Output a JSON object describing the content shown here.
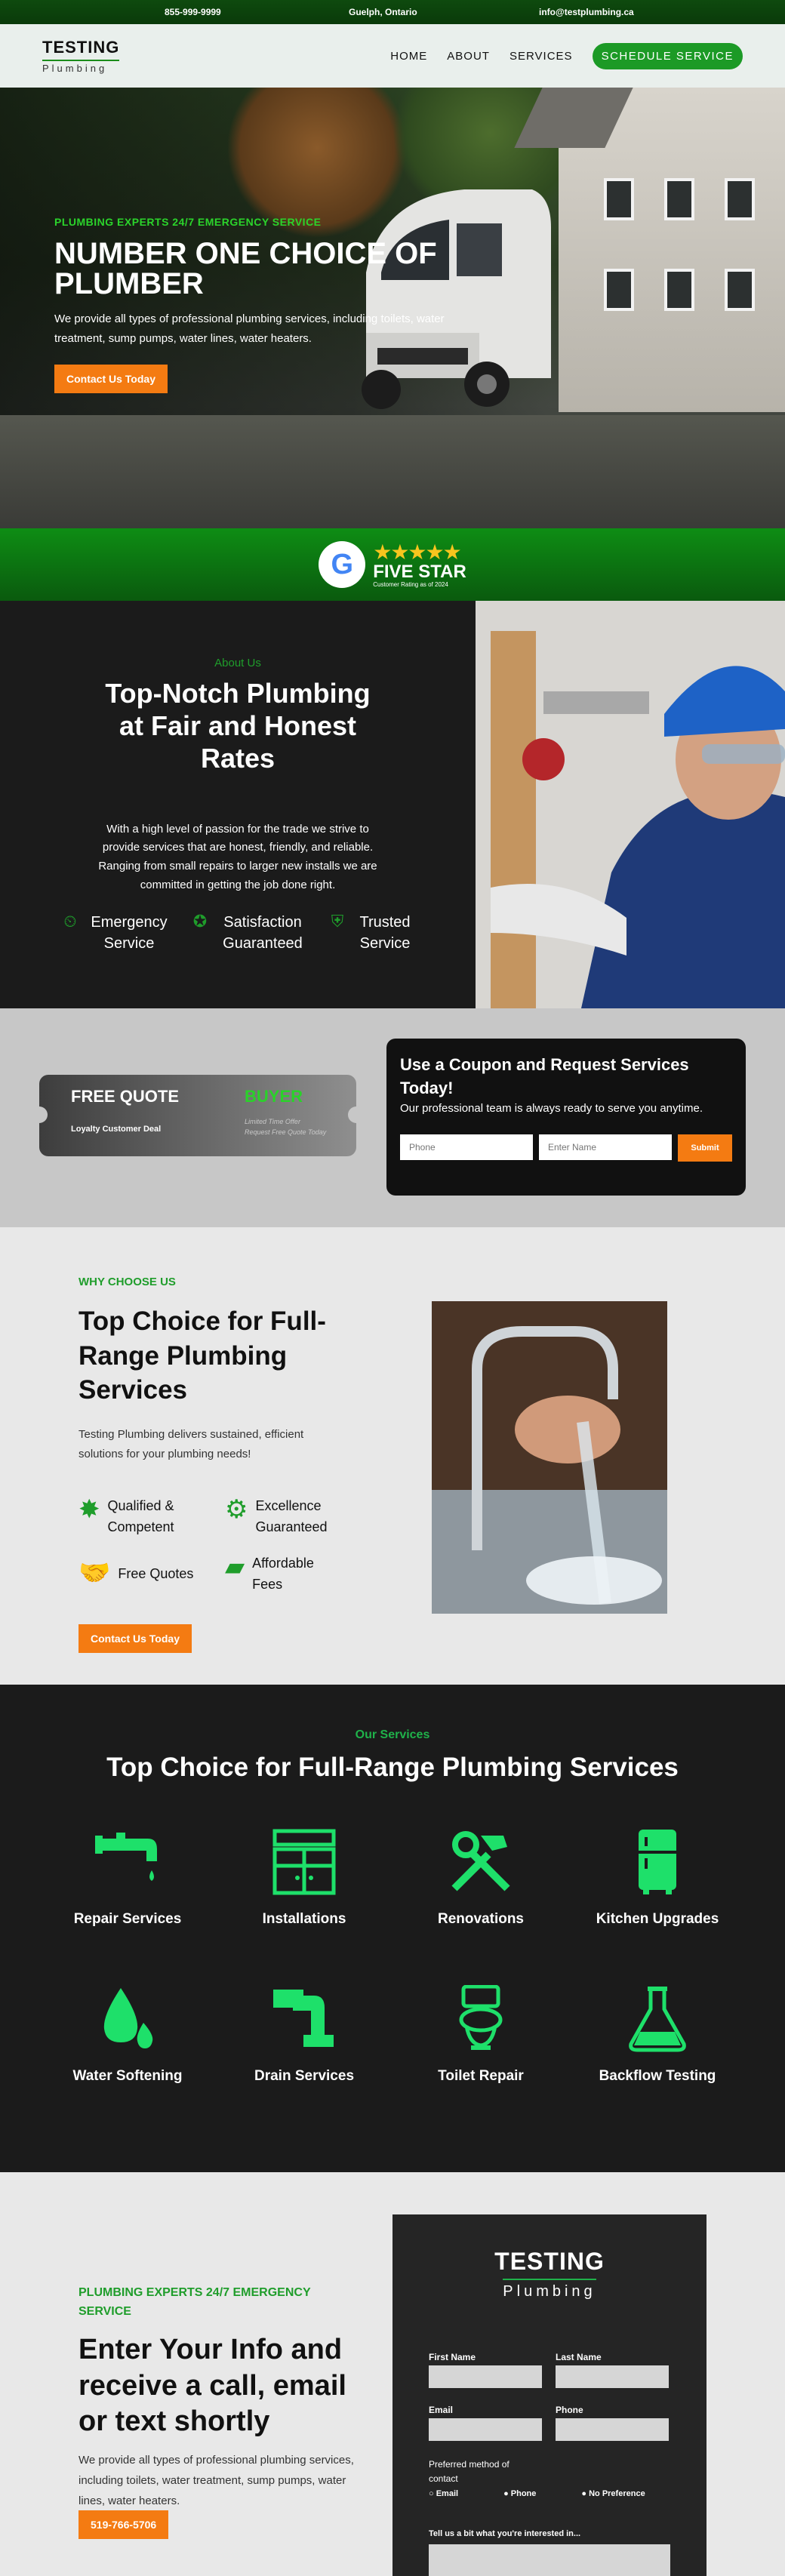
{
  "topbar": {
    "phone": "855-999-9999",
    "location": "Guelph, Ontario",
    "email": "info@testplumbing.ca"
  },
  "header": {
    "logo_title": "TESTING",
    "logo_sub": "Plumbing",
    "nav": [
      "HOME",
      "ABOUT",
      "SERVICES"
    ],
    "cta": "SCHEDULE SERVICE"
  },
  "hero": {
    "eyebrow": "PLUMBING EXPERTS 24/7 EMERGENCY SERVICE",
    "title": "NUMBER ONE CHOICE OF PLUMBER",
    "desc": "We provide all types of professional plumbing services, including toilets, water treatment, sump pumps, water lines, water heaters.",
    "cta": "Contact Us Today"
  },
  "review": {
    "google_letter": "G",
    "stars": "★★★★★",
    "label": "FIVE STAR",
    "note": "Customer Rating as of 2024"
  },
  "about": {
    "eyebrow": "About Us",
    "title": "Top-Notch Plumbing at Fair and Honest Rates",
    "desc": "With a high level of passion for the trade we strive to provide services that are honest, friendly, and reliable. Ranging from small repairs to larger new installs we are committed in getting the job done right.",
    "features": [
      {
        "icon": "clock-24-icon",
        "label": "Emergency Service"
      },
      {
        "icon": "award-icon",
        "label": "Satisfaction Guaranteed"
      },
      {
        "icon": "shield-check-icon",
        "label": "Trusted Service"
      }
    ]
  },
  "coupon": {
    "ticket_title": "FREE QUOTE",
    "ticket_sub": "Loyalty Customer Deal",
    "ticket_buyer": "BUYER",
    "ticket_limited": "Limited Time Offer",
    "ticket_request": "Request Free Quote Today",
    "box_title": "Use a Coupon and Request Services Today!",
    "box_sub": "Our professional team is always ready to serve you anytime.",
    "phone_placeholder": "Phone",
    "name_placeholder": "Enter Name",
    "submit": "Submit"
  },
  "why": {
    "eyebrow": "WHY CHOOSE US",
    "title": "Top Choice for Full-Range Plumbing Services",
    "desc": "Testing Plumbing delivers sustained, efficient solutions for your plumbing needs!",
    "features": [
      {
        "icon": "star-badge-icon",
        "label": "Qualified & Competent"
      },
      {
        "icon": "gear-badge-icon",
        "label": "Excellence Guaranteed"
      },
      {
        "icon": "handshake-icon",
        "label": "Free Quotes"
      },
      {
        "icon": "wallet-icon",
        "label": "Affordable Fees"
      }
    ],
    "cta": "Contact Us Today"
  },
  "services": {
    "eyebrow": "Our Services",
    "title": "Top Choice for Full-Range Plumbing Services",
    "items": [
      {
        "icon": "faucet-icon",
        "label": "Repair Services"
      },
      {
        "icon": "cabinet-icon",
        "label": "Installations"
      },
      {
        "icon": "tools-icon",
        "label": "Renovations"
      },
      {
        "icon": "fridge-icon",
        "label": "Kitchen Upgrades"
      },
      {
        "icon": "water-drops-icon",
        "label": "Water Softening"
      },
      {
        "icon": "pipe-icon",
        "label": "Drain Services"
      },
      {
        "icon": "toilet-icon",
        "label": "Toilet Repair"
      },
      {
        "icon": "flask-icon",
        "label": "Backflow Testing"
      }
    ]
  },
  "contact": {
    "eyebrow": "PLUMBING EXPERTS 24/7 EMERGENCY SERVICE",
    "title": "Enter Your Info and receive a call, email or text shortly",
    "desc": "We provide all types of professional plumbing services, including toilets, water treatment, sump pumps, water lines, water heaters.",
    "phone_cta": "519-766-5706",
    "form": {
      "logo_title": "TESTING",
      "logo_sub": "Plumbing",
      "first_name": "First Name",
      "last_name": "Last Name",
      "email": "Email",
      "phone": "Phone",
      "preferred": "Preferred method of contact",
      "opt_email": "Email",
      "opt_phone": "Phone",
      "opt_none": "No Preference",
      "message": "Tell us a bit what you're interested in..."
    }
  },
  "colors": {
    "green": "#1f9d2b",
    "orange": "#f47b12",
    "dark": "#1b1b1b"
  }
}
